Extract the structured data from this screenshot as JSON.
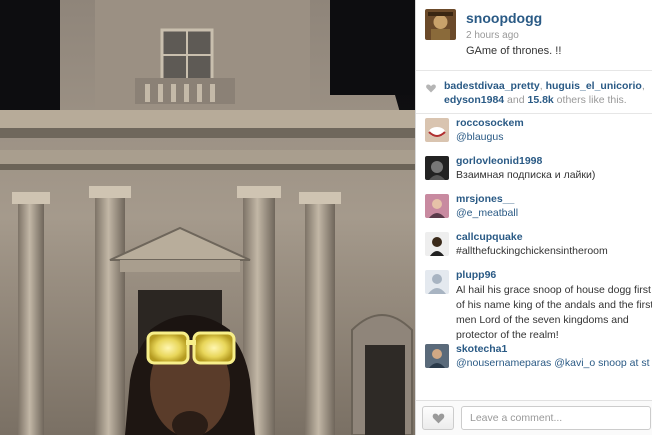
{
  "post": {
    "username": "snoopdogg",
    "time": "2 hours ago",
    "caption": "GAme of thrones. !!"
  },
  "likes": {
    "user1": "badestdivaa_pretty",
    "user2": "huguis_el_unicorio",
    "user3": "edyson1984",
    "connector": " and ",
    "others_count": "15.8k",
    "suffix": " others like this."
  },
  "comments": [
    {
      "name": "roccosockem",
      "text": "@blaugus",
      "link": true
    },
    {
      "name": "gorlovleonid1998",
      "text": "Взаимная подписка и лайки)",
      "link": false
    },
    {
      "name": "mrsjones__",
      "text": "@e_meatball",
      "link": true
    },
    {
      "name": "callcupquake",
      "text": "#allthefuckingchickensintheroom",
      "link": false
    },
    {
      "name": "plupp96",
      "text": "Al hail his grace snoop of house dogg first of his name king of the andals and the first men Lord of the seven kingdoms and protector of the realm!",
      "link": false
    },
    {
      "name": "skotecha1",
      "text": "@nousernameparas @kavi_o snoop at st ydav?",
      "link": true
    }
  ],
  "footer": {
    "placeholder": "Leave a comment..."
  },
  "colors": {
    "link_blue": "#2a5a85",
    "muted": "#999999"
  },
  "icons": {
    "like": "heart-icon",
    "likes_summary": "heart-icon"
  }
}
